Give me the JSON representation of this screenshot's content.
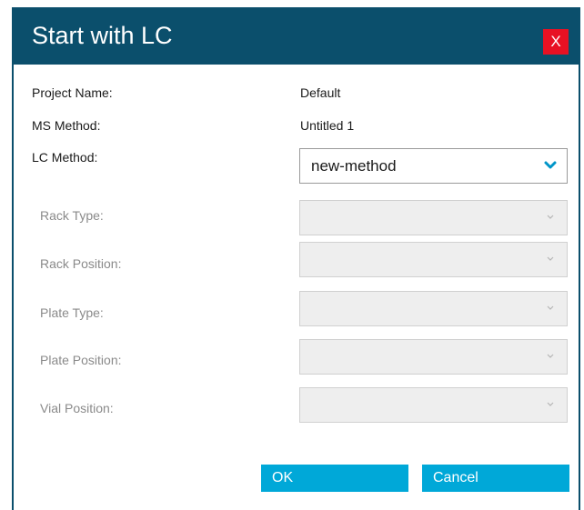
{
  "dialog": {
    "title": "Start with LC",
    "close_label": "X"
  },
  "fields": {
    "project_name": {
      "label": "Project Name:",
      "value": "Default"
    },
    "ms_method": {
      "label": "MS Method:",
      "value": "Untitled 1"
    },
    "lc_method": {
      "label": "LC Method:",
      "selected": "new-method"
    },
    "rack_type": {
      "label": "Rack Type:",
      "selected": ""
    },
    "rack_position": {
      "label": "Rack Position:",
      "selected": ""
    },
    "plate_type": {
      "label": "Plate Type:",
      "selected": ""
    },
    "plate_position": {
      "label": "Plate Position:",
      "selected": ""
    },
    "vial_position": {
      "label": "Vial Position:",
      "selected": ""
    }
  },
  "buttons": {
    "ok_label": "OK",
    "cancel_label": "Cancel"
  },
  "colors": {
    "titlebar": "#0b4f6c",
    "close": "#e81123",
    "button": "#00a8d8",
    "chevron_active": "#0095c8",
    "chevron_disabled": "#b5b5b5"
  },
  "icons": {
    "close": "close-icon",
    "dropdown": "chevron-down-icon"
  }
}
